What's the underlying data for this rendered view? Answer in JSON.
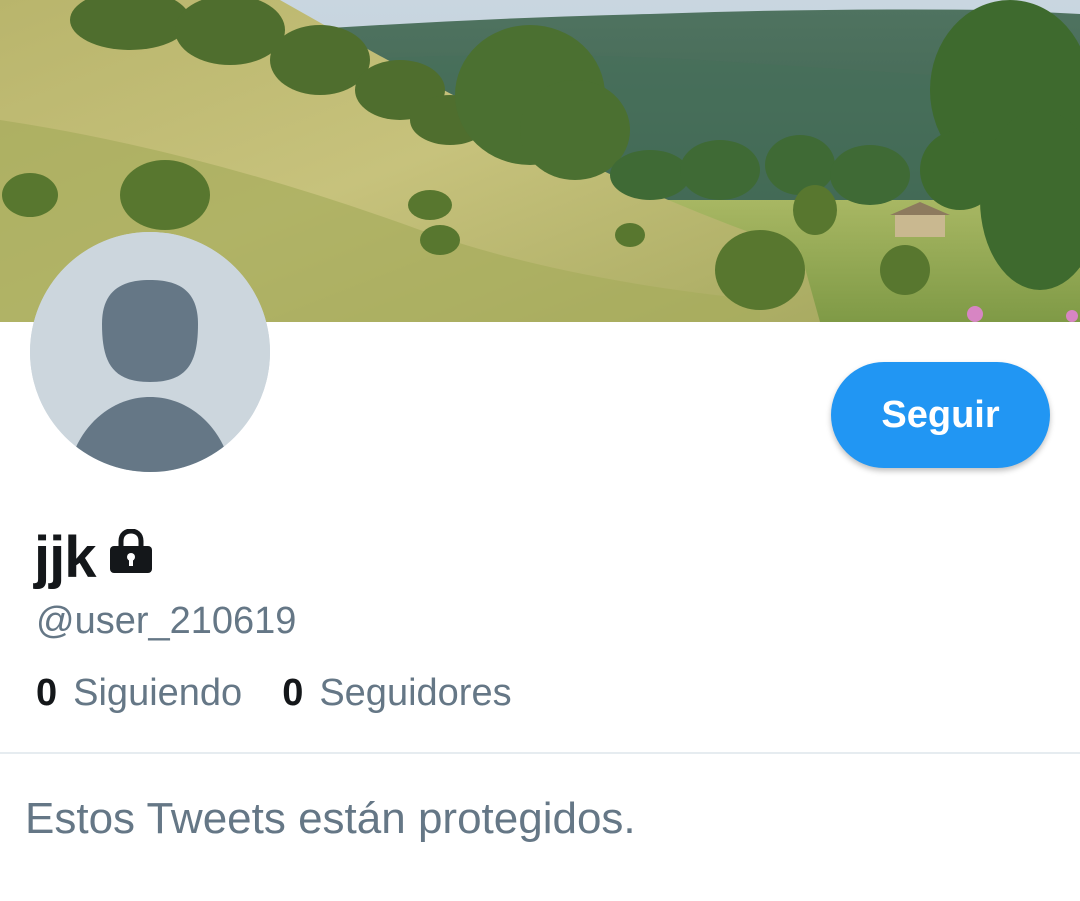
{
  "profile": {
    "display_name": "jjk",
    "handle": "@user_210619",
    "protected": true
  },
  "actions": {
    "follow_label": "Seguir"
  },
  "stats": {
    "following_count": "0",
    "following_label": "Siguiendo",
    "followers_count": "0",
    "followers_label": "Seguidores"
  },
  "timeline": {
    "protected_message": "Estos Tweets están protegidos."
  },
  "colors": {
    "accent": "#2196f3",
    "text_primary": "#14171a",
    "text_secondary": "#657786",
    "avatar_bg": "#ccd6dd",
    "avatar_fg": "#657786",
    "divider": "#e6ecf0"
  },
  "icons": {
    "lock": "lock-icon",
    "default_avatar": "default-avatar-silhouette"
  }
}
